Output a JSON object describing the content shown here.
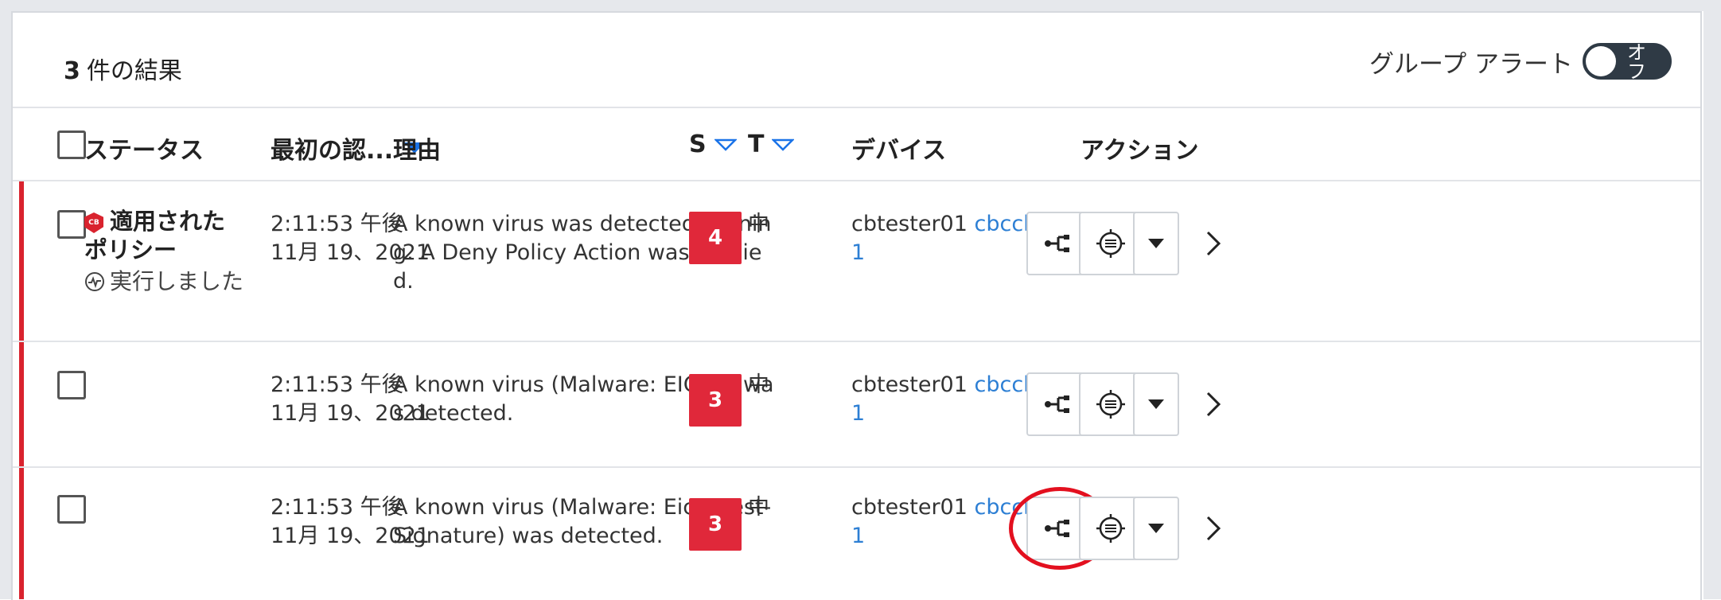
{
  "summary": {
    "count": "3",
    "label": "件の結果"
  },
  "group_alert": {
    "label": "グループ アラート",
    "toggle_text": "オフ"
  },
  "columns": {
    "status": "ステータス",
    "first_seen": "最初の認...",
    "reason": "理由",
    "severity": "S",
    "threat": "T",
    "device": "デバイス",
    "actions": "アクション"
  },
  "rows": [
    {
      "status_title": "適用されたポリシー",
      "status_badge": "CB",
      "status_sub": "実行しました",
      "time": "2:11:53 午後",
      "date": "11月 19、2021",
      "reason": "A known virus was detected running. A Deny Policy Action was applied.",
      "severity": "4",
      "threat": "中",
      "device_name": "cbtester01",
      "device_link": "cbccl501"
    },
    {
      "status_title": "",
      "status_badge": "",
      "status_sub": "",
      "time": "2:11:53 午後",
      "date": "11月 19、2021",
      "reason": "A known virus (Malware: EICAR) was detected.",
      "severity": "3",
      "threat": "中",
      "device_name": "cbtester01",
      "device_link": "cbccl501"
    },
    {
      "status_title": "",
      "status_badge": "",
      "status_sub": "",
      "time": "2:11:53 午後",
      "date": "11月 19、2021",
      "reason": "A known virus (Malware: Eicar-Test-Signature) was detected.",
      "severity": "3",
      "threat": "中",
      "device_name": "cbtester01",
      "device_link": "cbccl501"
    }
  ],
  "icons": {
    "process_tree": "process-tree-icon",
    "investigate": "target-icon",
    "dropdown": "caret-down-icon",
    "expand": "chevron-right-icon",
    "sort_active": "sort-desc-filled-icon",
    "sort_inactive": "sort-desc-outline-icon"
  },
  "colors": {
    "accent_red": "#d9232e",
    "severity_red": "#e0283a",
    "link_blue": "#2d7fd4",
    "sort_blue": "#1a73e8",
    "annotation_red": "#e3101f"
  },
  "annotation": {
    "highlighted": "row-3-process-tree-button"
  }
}
